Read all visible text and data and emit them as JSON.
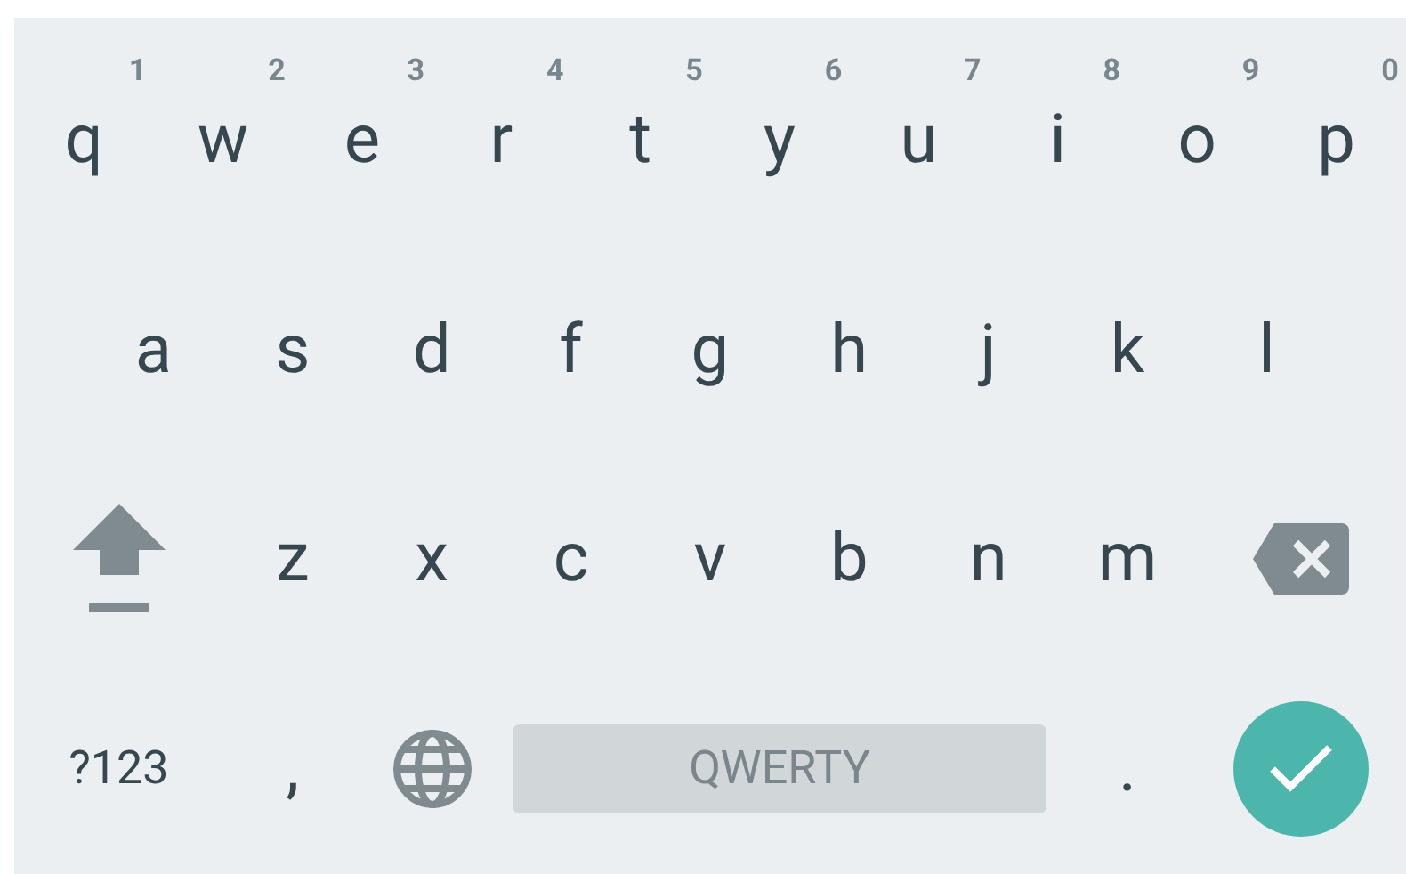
{
  "rows": [
    {
      "keys": [
        {
          "kind": "letter",
          "label": "q",
          "hint": "1"
        },
        {
          "kind": "letter",
          "label": "w",
          "hint": "2"
        },
        {
          "kind": "letter",
          "label": "e",
          "hint": "3"
        },
        {
          "kind": "letter",
          "label": "r",
          "hint": "4"
        },
        {
          "kind": "letter",
          "label": "t",
          "hint": "5"
        },
        {
          "kind": "letter",
          "label": "y",
          "hint": "6"
        },
        {
          "kind": "letter",
          "label": "u",
          "hint": "7"
        },
        {
          "kind": "letter",
          "label": "i",
          "hint": "8"
        },
        {
          "kind": "letter",
          "label": "o",
          "hint": "9"
        },
        {
          "kind": "letter",
          "label": "p",
          "hint": "0"
        }
      ]
    },
    {
      "keys": [
        {
          "kind": "letter",
          "label": "a"
        },
        {
          "kind": "letter",
          "label": "s"
        },
        {
          "kind": "letter",
          "label": "d"
        },
        {
          "kind": "letter",
          "label": "f"
        },
        {
          "kind": "letter",
          "label": "g"
        },
        {
          "kind": "letter",
          "label": "h"
        },
        {
          "kind": "letter",
          "label": "j"
        },
        {
          "kind": "letter",
          "label": "k"
        },
        {
          "kind": "letter",
          "label": "l"
        }
      ]
    },
    {
      "keys": [
        {
          "kind": "shift"
        },
        {
          "kind": "letter",
          "label": "z"
        },
        {
          "kind": "letter",
          "label": "x"
        },
        {
          "kind": "letter",
          "label": "c"
        },
        {
          "kind": "letter",
          "label": "v"
        },
        {
          "kind": "letter",
          "label": "b"
        },
        {
          "kind": "letter",
          "label": "n"
        },
        {
          "kind": "letter",
          "label": "m"
        },
        {
          "kind": "backspace"
        }
      ]
    },
    {
      "keys": [
        {
          "kind": "symbols",
          "label": "?123"
        },
        {
          "kind": "letter",
          "label": ","
        },
        {
          "kind": "language"
        },
        {
          "kind": "space",
          "label": "QWERTY"
        },
        {
          "kind": "letter",
          "label": "."
        },
        {
          "kind": "enter"
        }
      ]
    }
  ]
}
